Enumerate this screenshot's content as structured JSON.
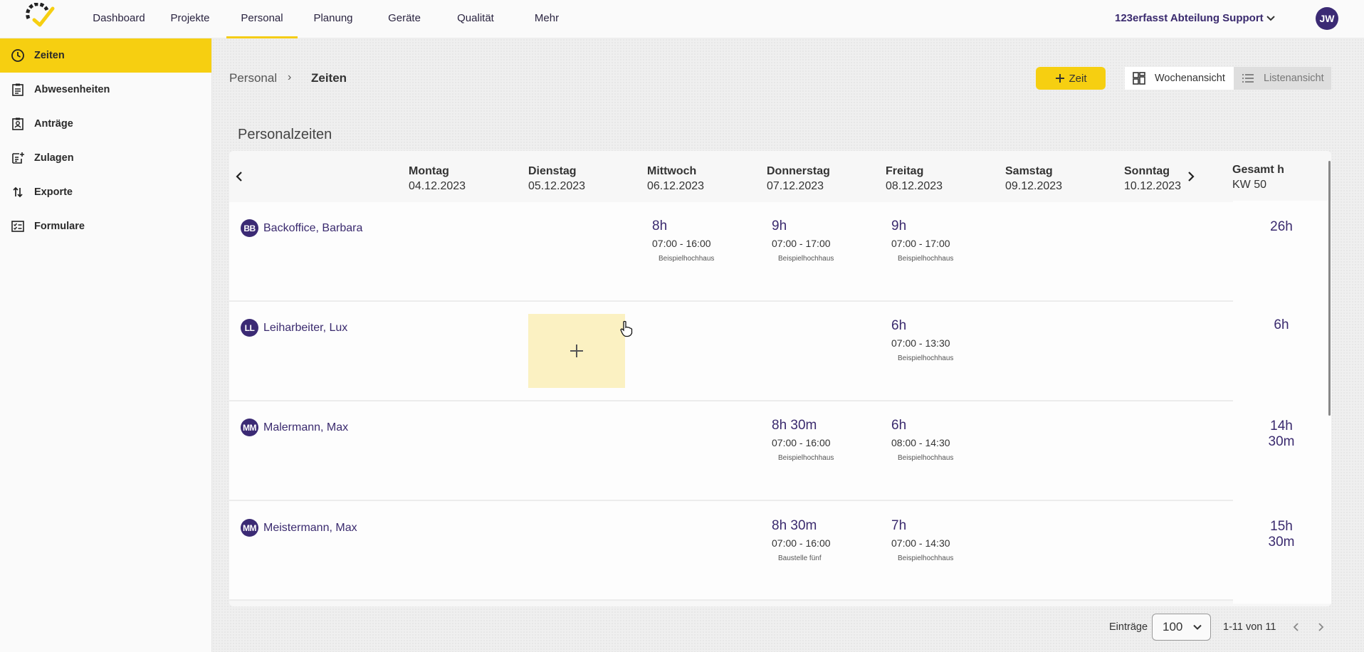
{
  "nav": {
    "items": [
      "Dashboard",
      "Projekte",
      "Personal",
      "Planung",
      "Geräte",
      "Qualität",
      "Mehr"
    ],
    "active": "Personal",
    "org": "123erfasst Abteilung Support",
    "user_initials": "JW"
  },
  "sidebar": {
    "items": [
      {
        "label": "Zeiten",
        "icon": "clock-icon"
      },
      {
        "label": "Abwesenheiten",
        "icon": "clipboard-icon"
      },
      {
        "label": "Anträge",
        "icon": "badge-icon"
      },
      {
        "label": "Zulagen",
        "icon": "note-add-icon"
      },
      {
        "label": "Exporte",
        "icon": "swap-vert-icon"
      },
      {
        "label": "Formulare",
        "icon": "checklist-icon"
      }
    ],
    "active": "Zeiten"
  },
  "breadcrumb": {
    "parent": "Personal",
    "separator": "›",
    "current": "Zeiten"
  },
  "toolbar": {
    "add_label": "Zeit",
    "week_view": "Wochenansicht",
    "list_view": "Listenansicht"
  },
  "page_title": "Personalzeiten",
  "week": {
    "days": [
      {
        "name": "Montag",
        "date": "04.12.2023"
      },
      {
        "name": "Dienstag",
        "date": "05.12.2023"
      },
      {
        "name": "Mittwoch",
        "date": "06.12.2023"
      },
      {
        "name": "Donnerstag",
        "date": "07.12.2023"
      },
      {
        "name": "Freitag",
        "date": "08.12.2023"
      },
      {
        "name": "Samstag",
        "date": "09.12.2023"
      },
      {
        "name": "Sonntag",
        "date": "10.12.2023"
      }
    ],
    "total_label": "Gesamt h",
    "kw_label": "KW 50"
  },
  "employees": [
    {
      "initials": "BB",
      "name": "Backoffice, Barbara",
      "total": "26h",
      "entries": [
        {
          "hours": "8h",
          "time": "07:00 - 16:00",
          "project": "Beispielhochhaus"
        },
        {
          "hours": "9h",
          "time": "07:00 - 17:00",
          "project": "Beispielhochhaus"
        },
        {
          "hours": "9h",
          "time": "07:00 - 17:00",
          "project": "Beispielhochhaus"
        }
      ]
    },
    {
      "initials": "LL",
      "name": "Leiharbeiter, Lux",
      "total": "6h",
      "entries": [
        {
          "hours": "6h",
          "time": "07:00 - 13:30",
          "project": "Beispielhochhaus"
        }
      ]
    },
    {
      "initials": "MM",
      "name": "Malermann, Max",
      "total": "14h 30m",
      "entries": [
        {
          "hours": "8h 30m",
          "time": "07:00 - 16:00",
          "project": "Beispielhochhaus"
        },
        {
          "hours": "6h",
          "time": "08:00 - 14:30",
          "project": "Beispielhochhaus"
        }
      ]
    },
    {
      "initials": "MM",
      "name": "Meistermann, Max",
      "total": "15h 30m",
      "entries": [
        {
          "hours": "8h 30m",
          "time": "07:00 - 16:00",
          "project": "Baustelle fünf"
        },
        {
          "hours": "7h",
          "time": "07:00 - 14:30",
          "project": "Beispielhochhaus"
        }
      ]
    }
  ],
  "pagination": {
    "label": "Einträge",
    "page_size": "100",
    "range": "1-11 von 11"
  },
  "colors": {
    "accent": "#f6cf11",
    "brand": "#3b2a74"
  }
}
